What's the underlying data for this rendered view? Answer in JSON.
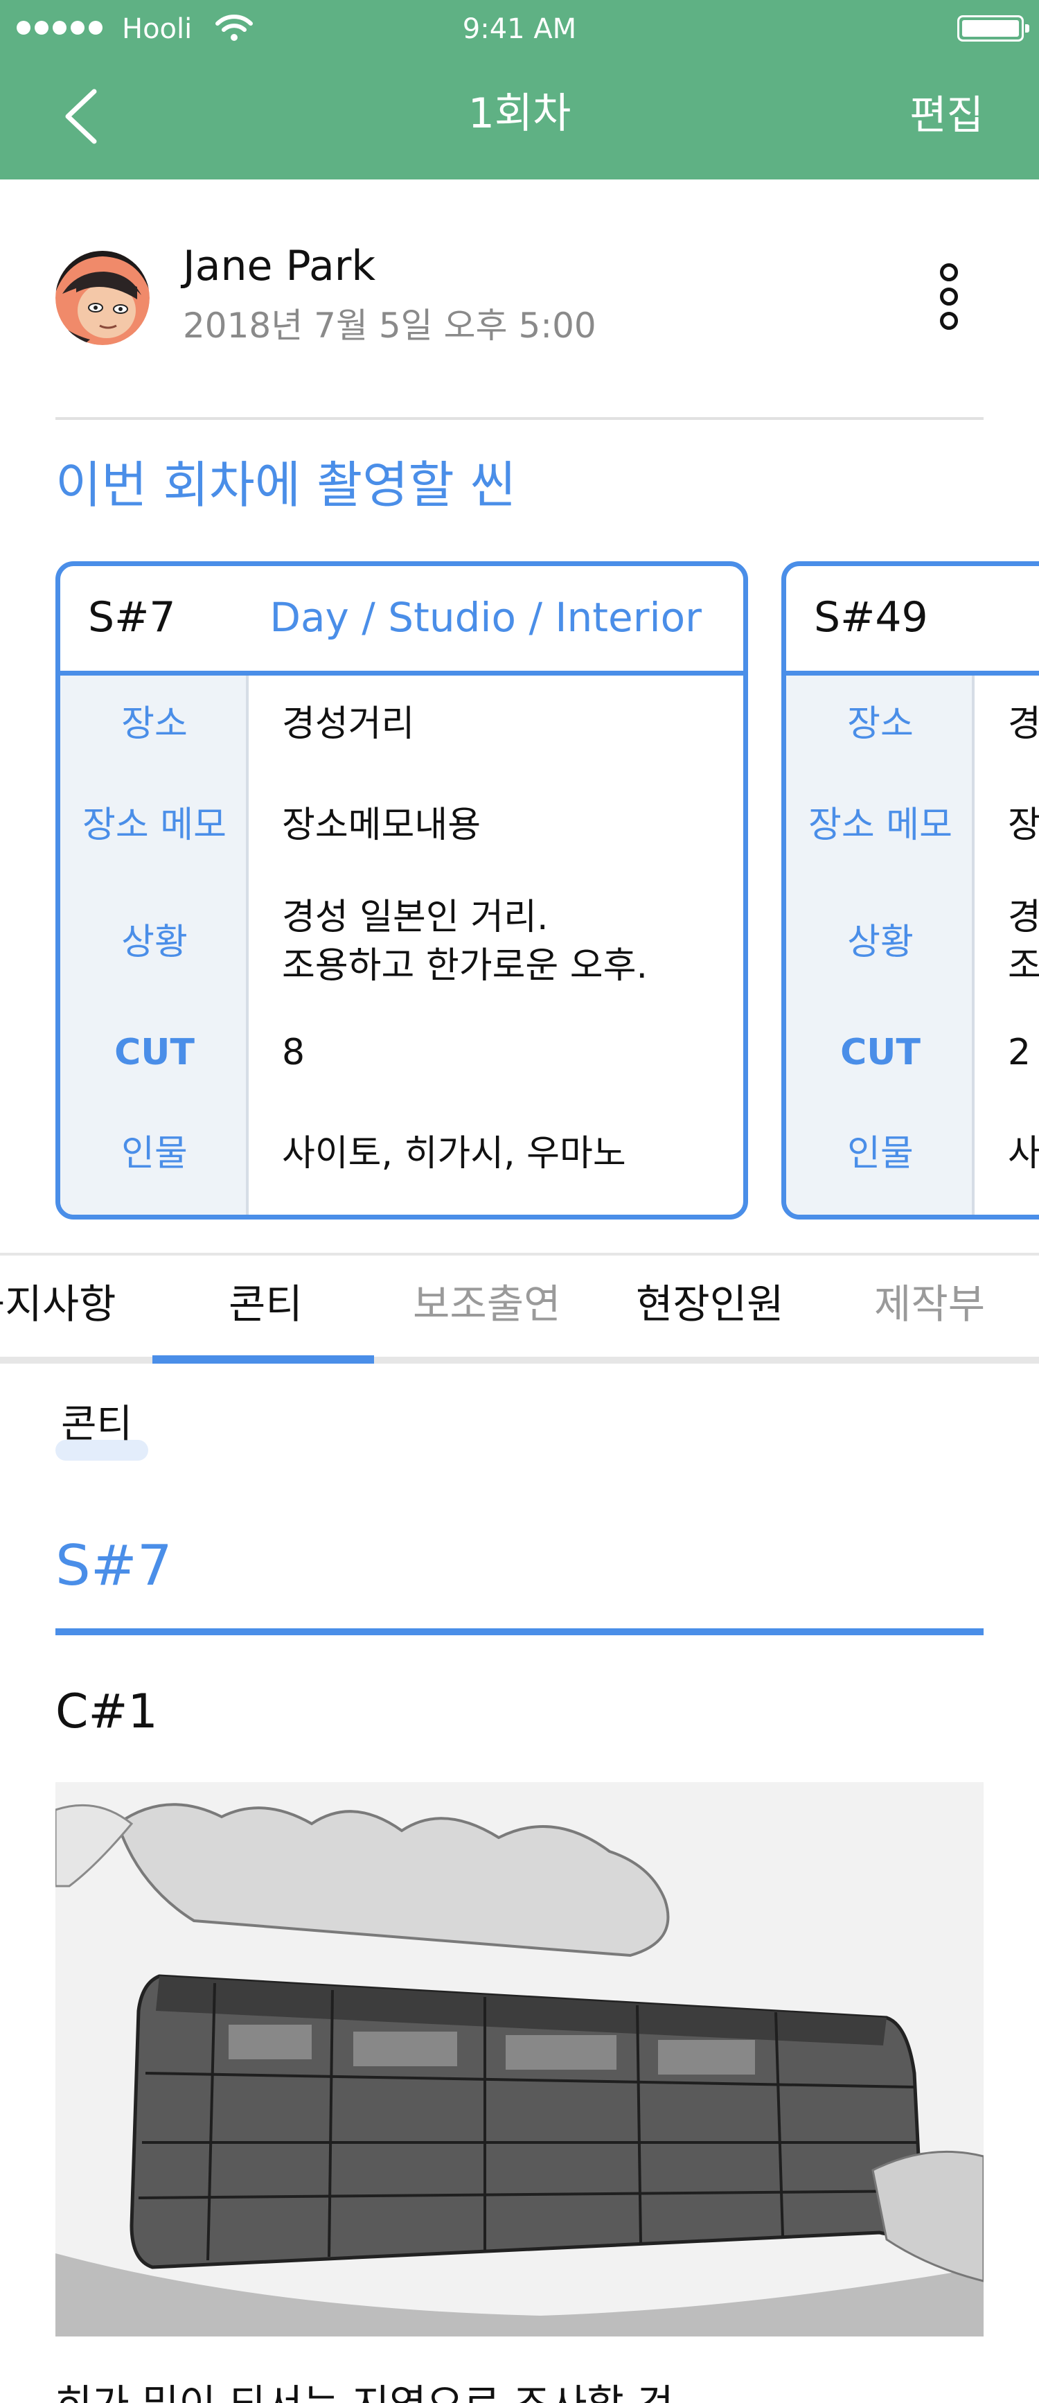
{
  "status_bar": {
    "carrier": "Hooli",
    "time": "9:41 AM"
  },
  "nav": {
    "title": "1회차",
    "edit_label": "편집",
    "back_icon": "chevron-left-icon"
  },
  "author": {
    "name": "Jane Park",
    "date": "2018년 7월 5일 오후 5:00"
  },
  "section_title": "이번 회차에 촬영할 씬",
  "scene_cards": [
    {
      "scene_no": "S#7",
      "tag": "Day / Studio / Interior",
      "rows": [
        {
          "label": "장소",
          "value": "경성거리"
        },
        {
          "label": "장소 메모",
          "value": "장소메모내용"
        },
        {
          "label": "상황",
          "value_lines": [
            "경성 일본인 거리.",
            "조용하고 한가로운 오후."
          ]
        },
        {
          "label": "CUT",
          "value": "8"
        },
        {
          "label": "인물",
          "value": "사이토, 히가시, 우마노"
        }
      ]
    },
    {
      "scene_no": "S#49",
      "tag": "",
      "rows": [
        {
          "label": "장소",
          "value": "경"
        },
        {
          "label": "장소 메모",
          "value": "장"
        },
        {
          "label": "상황",
          "value_lines": [
            "경",
            "조"
          ]
        },
        {
          "label": "CUT",
          "value": "2"
        },
        {
          "label": "인물",
          "value": "사"
        }
      ]
    }
  ],
  "tabs": [
    {
      "label": "공지사항",
      "active": false
    },
    {
      "label": "콘티",
      "active": true
    },
    {
      "label": "보조출연",
      "active": false
    },
    {
      "label": "현장인원",
      "active": false
    },
    {
      "label": "제작부",
      "active": false
    }
  ],
  "content": {
    "chip_label": "콘티",
    "scene_heading": "S#7",
    "cut_heading": "C#1",
    "caption": "히가 밑이 되서는 지역으로 조사할 것"
  },
  "colors": {
    "header_green": "#5fb184",
    "accent_blue": "#4a8ee8",
    "muted_gray": "#8a8a8a"
  }
}
